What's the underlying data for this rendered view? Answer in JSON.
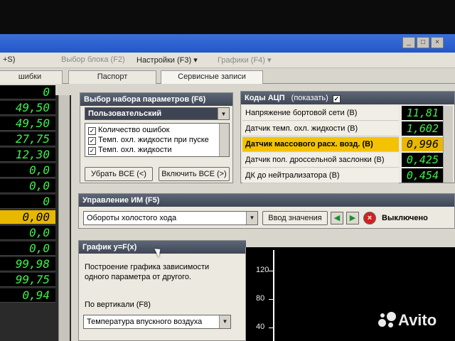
{
  "window": {
    "buttons": [
      "_",
      "□",
      "×"
    ]
  },
  "menu": {
    "left_fragment": "+S)",
    "block_select": "Выбор блока (F2)",
    "settings": "Настройки (F3) ▾",
    "charts": "Графики (F4) ▾"
  },
  "tabs": {
    "errors_fragment": "шибки",
    "passport": "Паспорт",
    "service_records": "Сервисные записи"
  },
  "left_values": [
    "0",
    "49,50",
    "49,50",
    "27,75",
    "12,30",
    "0,0",
    "0,0",
    "0",
    "0,00",
    "0,0",
    "0,0",
    "99,98",
    "99,75",
    "0,94"
  ],
  "left_highlight_index": 8,
  "param_set": {
    "header": "Выбор набора параметров (F6)",
    "selected": "Пользовательский",
    "items": [
      {
        "label": "Количество ошибок",
        "checked": true
      },
      {
        "label": "Темп. охл. жидкости при пуске",
        "checked": true
      },
      {
        "label": "Темп. охл. жидкости",
        "checked": true
      }
    ],
    "remove_all": "Убрать ВСЕ (<)",
    "include_all": "Включить ВСЕ (>)"
  },
  "adc": {
    "header": "Коды АЦП",
    "show_label": "(показать)",
    "show_checked": true,
    "rows": [
      {
        "label": "Напряжение бортовой сети (В)",
        "value": "11,81",
        "highlight": false
      },
      {
        "label": "Датчик темп. охл. жидкости (В)",
        "value": "1,602",
        "highlight": false
      },
      {
        "label": "Датчик массового расх. возд. (В)",
        "value": "0,996",
        "highlight": true
      },
      {
        "label": "Датчик пол. дроссельной заслонки (В)",
        "value": "0,425",
        "highlight": false
      },
      {
        "label": "ДК до нейтрализатора (В)",
        "value": "0,454",
        "highlight": false
      }
    ]
  },
  "im_control": {
    "header": "Управление ИМ (F5)",
    "selected": "Обороты холостого хода",
    "input_button": "Ввод значения",
    "state": "Выключено"
  },
  "graph": {
    "header": "График y=F(x)",
    "description": "Построение графика зависимости одного параметра от другого.",
    "vertical_label": "По вертикали (F8)",
    "vertical_selected": "Температура впускного воздуха",
    "ticks": [
      "120",
      "80",
      "40"
    ]
  },
  "watermark": "Avito"
}
